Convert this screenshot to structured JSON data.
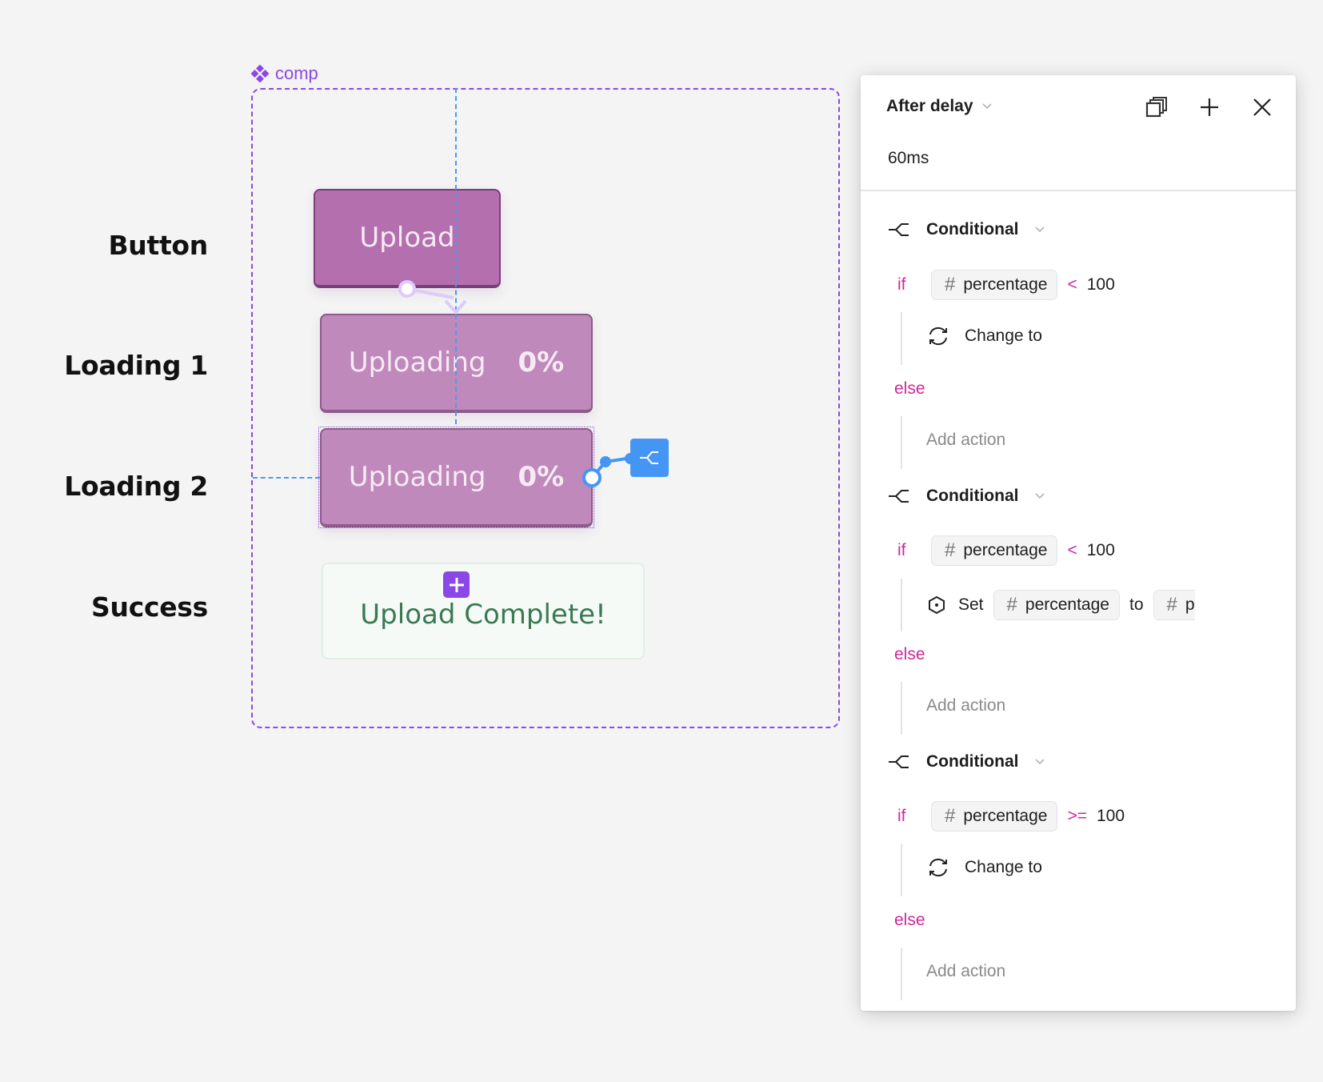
{
  "canvas": {
    "component_name": "comp",
    "state_labels": [
      "Button",
      "Loading 1",
      "Loading 2",
      "Success"
    ],
    "upload_button": {
      "label": "Upload"
    },
    "loading_1": {
      "label": "Uploading",
      "percent": "0%"
    },
    "loading_2": {
      "label": "Uploading",
      "percent": "0%"
    },
    "success": {
      "label": "Upload Complete!"
    },
    "colors": {
      "frame": "#8a48e8",
      "button_fill": "#b46faf",
      "loading_fill": "#c089bc",
      "success_text": "#3a7a52",
      "guide": "#4a9bf0",
      "connector_selected": "#4596f4",
      "connector_default": "#dccbfb"
    }
  },
  "panel": {
    "trigger": "After delay",
    "delay": "60ms",
    "header_icons": [
      "copies-icon",
      "plus-icon",
      "close-icon"
    ],
    "conditionals": [
      {
        "title": "Conditional",
        "if_keyword": "if",
        "variable": "percentage",
        "operator": "<",
        "value": "100",
        "action": {
          "type": "change-to",
          "label": "Change to"
        },
        "else_keyword": "else",
        "else_action": "Add action"
      },
      {
        "title": "Conditional",
        "if_keyword": "if",
        "variable": "percentage",
        "operator": "<",
        "value": "100",
        "action": {
          "type": "set-variable",
          "label": "Set",
          "target": "percentage",
          "to_label": "to",
          "expression": "percentage"
        },
        "else_keyword": "else",
        "else_action": "Add action"
      },
      {
        "title": "Conditional",
        "if_keyword": "if",
        "variable": "percentage",
        "operator": ">=",
        "value": "100",
        "action": {
          "type": "change-to",
          "label": "Change to"
        },
        "else_keyword": "else",
        "else_action": "Add action"
      }
    ],
    "colors": {
      "keyword": "#d0279a",
      "placeholder": "#8a8a8a"
    }
  }
}
